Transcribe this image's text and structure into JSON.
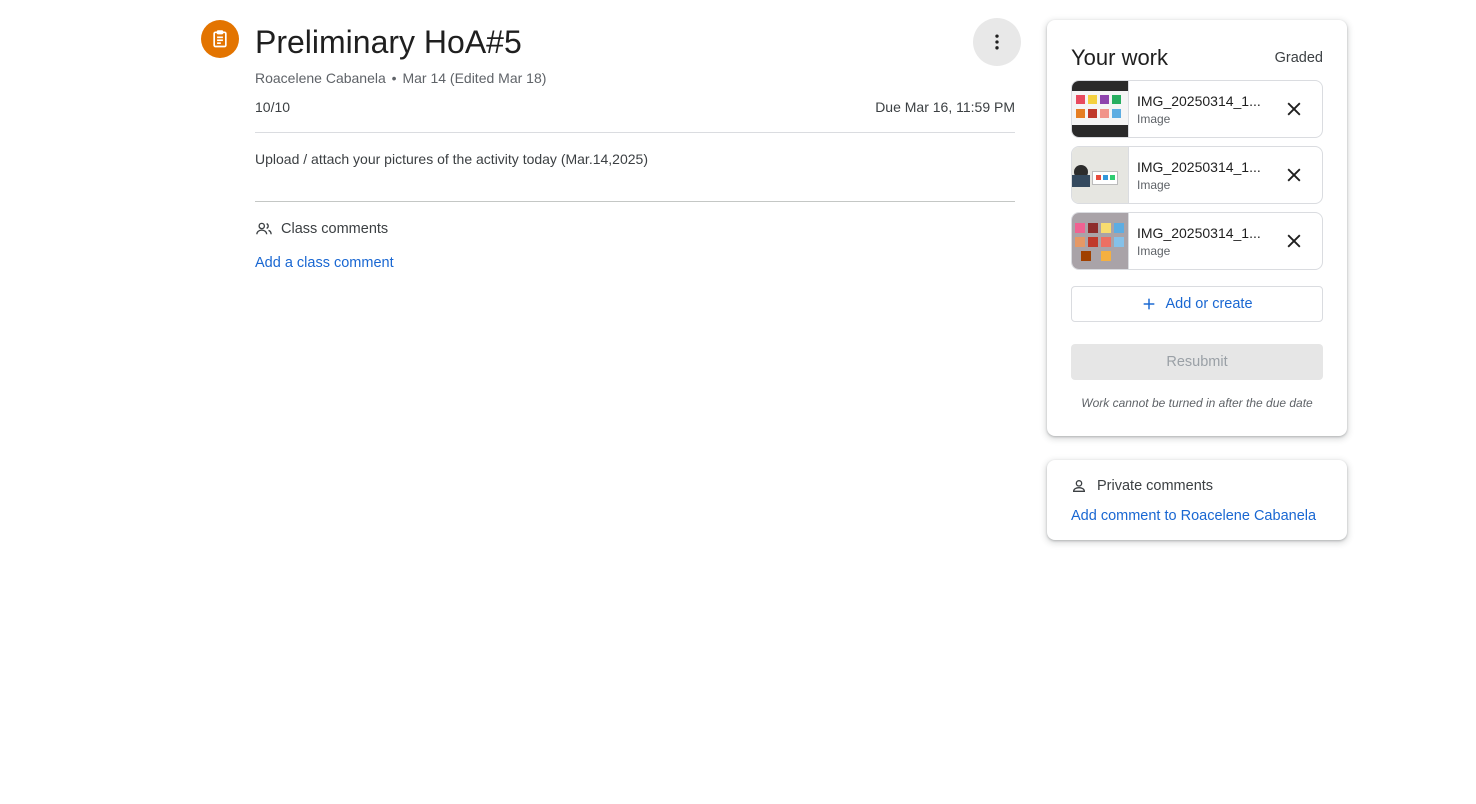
{
  "assignment": {
    "icon": "assignment-icon",
    "icon_color": "#e37400",
    "title": "Preliminary HoA#5",
    "author": "Roacelene Cabanela",
    "separator": "•",
    "posted": "Mar 14 (Edited Mar 18)",
    "points": "10/10",
    "due": "Due Mar 16, 11:59 PM",
    "instructions": "Upload / attach your pictures of the activity today (Mar.14,2025)"
  },
  "class_comments": {
    "icon": "people-icon",
    "label": "Class comments",
    "add_link": "Add a class comment"
  },
  "your_work": {
    "title": "Your work",
    "status": "Graded",
    "attachments": [
      {
        "name": "IMG_20250314_1...",
        "type": "Image"
      },
      {
        "name": "IMG_20250314_1...",
        "type": "Image"
      },
      {
        "name": "IMG_20250314_1...",
        "type": "Image"
      }
    ],
    "add_button": "Add or create",
    "resubmit_button": "Resubmit",
    "note": "Work cannot be turned in after the due date"
  },
  "private_comments": {
    "icon": "person-icon",
    "label": "Private comments",
    "add_link": "Add comment to Roacelene Cabanela"
  },
  "colors": {
    "link": "#1967d2",
    "accent": "#e37400"
  }
}
